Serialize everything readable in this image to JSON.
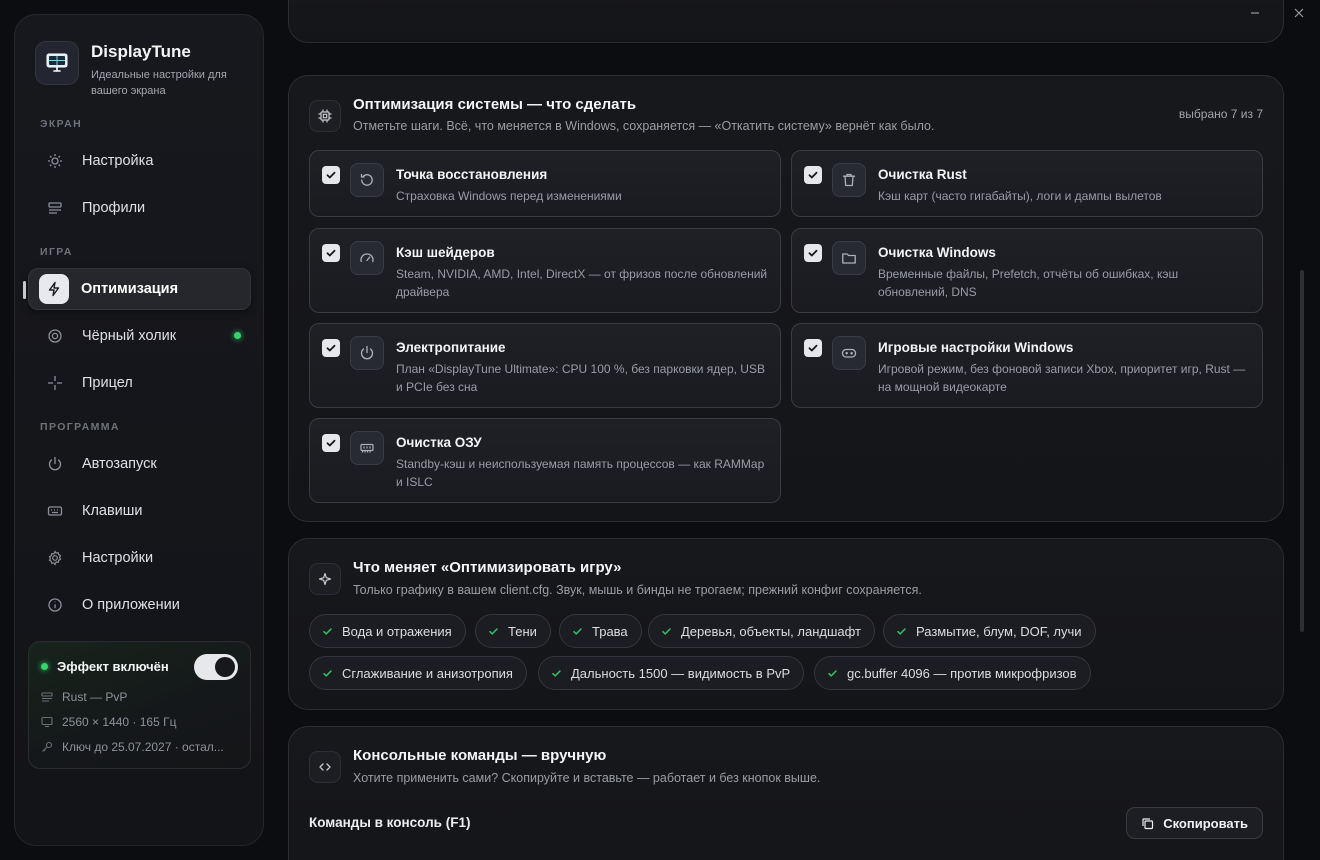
{
  "window": {
    "minimize_icon": "minimize-icon",
    "close_icon": "close-icon"
  },
  "brand": {
    "name": "DisplayTune",
    "subtitle": "Идеальные настройки для вашего экрана",
    "logo_icon": "monitor-icon"
  },
  "sidebar": {
    "sections": {
      "screen": "ЭКРАН",
      "game": "ИГРА",
      "program": "ПРОГРАММА"
    },
    "items": [
      {
        "label": "Настройка",
        "icon": "sun-icon"
      },
      {
        "label": "Профили",
        "icon": "profiles-icon"
      },
      {
        "label": "Оптимизация",
        "icon": "lightning-icon",
        "active": true
      },
      {
        "label": "Чёрный холик",
        "icon": "target-icon",
        "indicator": "online"
      },
      {
        "label": "Прицел",
        "icon": "crosshair-icon"
      },
      {
        "label": "Автозапуск",
        "icon": "power-icon"
      },
      {
        "label": "Клавиши",
        "icon": "keyboard-icon"
      },
      {
        "label": "Настройки",
        "icon": "gear-icon"
      },
      {
        "label": "О приложении",
        "icon": "info-icon"
      }
    ]
  },
  "effect": {
    "title": "Эффект включён",
    "enabled": true,
    "profile": "Rust — PvP",
    "resolution": "2560 × 1440 · 165 Гц",
    "license": "Ключ до 25.07.2027 · остал...",
    "accent_color": "#38d36c"
  },
  "optimization": {
    "title": "Оптимизация системы — что сделать",
    "subtitle": "Отметьте шаги. Всё, что меняется в Windows, сохраняется — «Откатить систему» вернёт как было.",
    "selected_count": "выбрано 7 из 7",
    "items": [
      {
        "title": "Точка восстановления",
        "desc": "Страховка Windows перед изменениями",
        "icon": "restore-icon",
        "checked": true
      },
      {
        "title": "Очистка Rust",
        "desc": "Кэш карт (часто гигабайты), логи и дампы вылетов",
        "icon": "trash-icon",
        "checked": true
      },
      {
        "title": "Кэш шейдеров",
        "desc": "Steam, NVIDIA, AMD, Intel, DirectX — от фризов после обновлений драйвера",
        "icon": "gauge-icon",
        "checked": true
      },
      {
        "title": "Очистка Windows",
        "desc": "Временные файлы, Prefetch, отчёты об ошибках, кэш обновлений, DNS",
        "icon": "folder-icon",
        "checked": true
      },
      {
        "title": "Электропитание",
        "desc": "План «DisplayTune Ultimate»: CPU 100 %, без парковки ядер, USB и PCIe без сна",
        "icon": "power-icon",
        "checked": true
      },
      {
        "title": "Игровые настройки Windows",
        "desc": "Игровой режим, без фоновой записи Xbox, приоритет игр, Rust — на мощной видеокарте",
        "icon": "gamepad-icon",
        "checked": true
      },
      {
        "title": "Очистка ОЗУ",
        "desc": "Standby-кэш и неиспользуемая память процессов — как RAMMap и ISLC",
        "icon": "memory-icon",
        "checked": true
      }
    ]
  },
  "game_opt": {
    "title": "Что меняет «Оптимизировать игру»",
    "subtitle": "Только графику в вашем client.cfg. Звук, мышь и бинды не трогаем; прежний конфиг сохраняется.",
    "chips": [
      "Вода и отражения",
      "Тени",
      "Трава",
      "Деревья, объекты, ландшафт",
      "Размытие, блум, DOF, лучи",
      "Сглаживание и анизотропия",
      "Дальность 1500 — видимость в PvP",
      "gc.buffer 4096 — против микрофризов"
    ],
    "check_color": "#33c465"
  },
  "console": {
    "title": "Консольные команды — вручную",
    "subtitle": "Хотите применить сами? Скопируйте и вставьте — работает и без кнопок выше.",
    "commands_label": "Команды в консоль (F1)",
    "copy_label": "Скопировать"
  }
}
